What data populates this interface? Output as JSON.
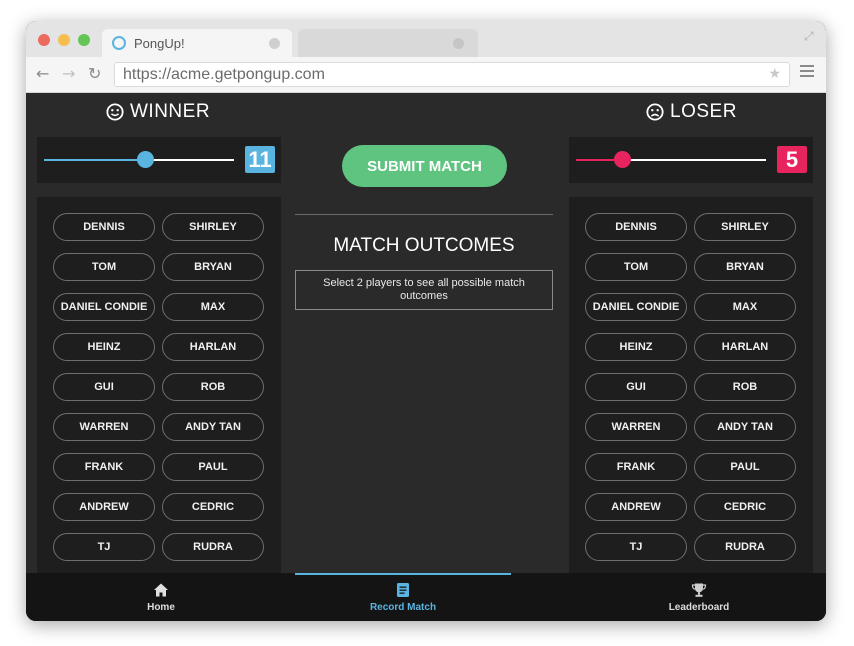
{
  "browser": {
    "tab_title": "PongUp!",
    "url": "https://acme.getpongup.com"
  },
  "winner": {
    "title": "WINNER",
    "score": "11",
    "score_fraction": 0.53,
    "accent": "#5ab4e0",
    "players": [
      "DENNIS",
      "SHIRLEY",
      "TOM",
      "BRYAN",
      "DANIEL CONDIE",
      "MAX",
      "HEINZ",
      "HARLAN",
      "GUI",
      "ROB",
      "WARREN",
      "ANDY TAN",
      "FRANK",
      "PAUL",
      "ANDREW",
      "CEDRIC",
      "TJ",
      "RUDRA"
    ]
  },
  "loser": {
    "title": "LOSER",
    "score": "5",
    "score_fraction": 0.24,
    "accent": "#e8245f",
    "players": [
      "DENNIS",
      "SHIRLEY",
      "TOM",
      "BRYAN",
      "DANIEL CONDIE",
      "MAX",
      "HEINZ",
      "HARLAN",
      "GUI",
      "ROB",
      "WARREN",
      "ANDY TAN",
      "FRANK",
      "PAUL",
      "ANDREW",
      "CEDRIC",
      "TJ",
      "RUDRA"
    ]
  },
  "center": {
    "submit_label": "SUBMIT MATCH",
    "outcomes_title": "MATCH OUTCOMES",
    "outcomes_hint": "Select 2 players to see all possible match outcomes"
  },
  "bottom_nav": {
    "home": "Home",
    "record": "Record Match",
    "leaderboard": "Leaderboard"
  },
  "icons": {
    "winner": "smile-icon",
    "loser": "frown-icon",
    "home": "home-icon",
    "record": "document-icon",
    "leaderboard": "trophy-icon"
  }
}
